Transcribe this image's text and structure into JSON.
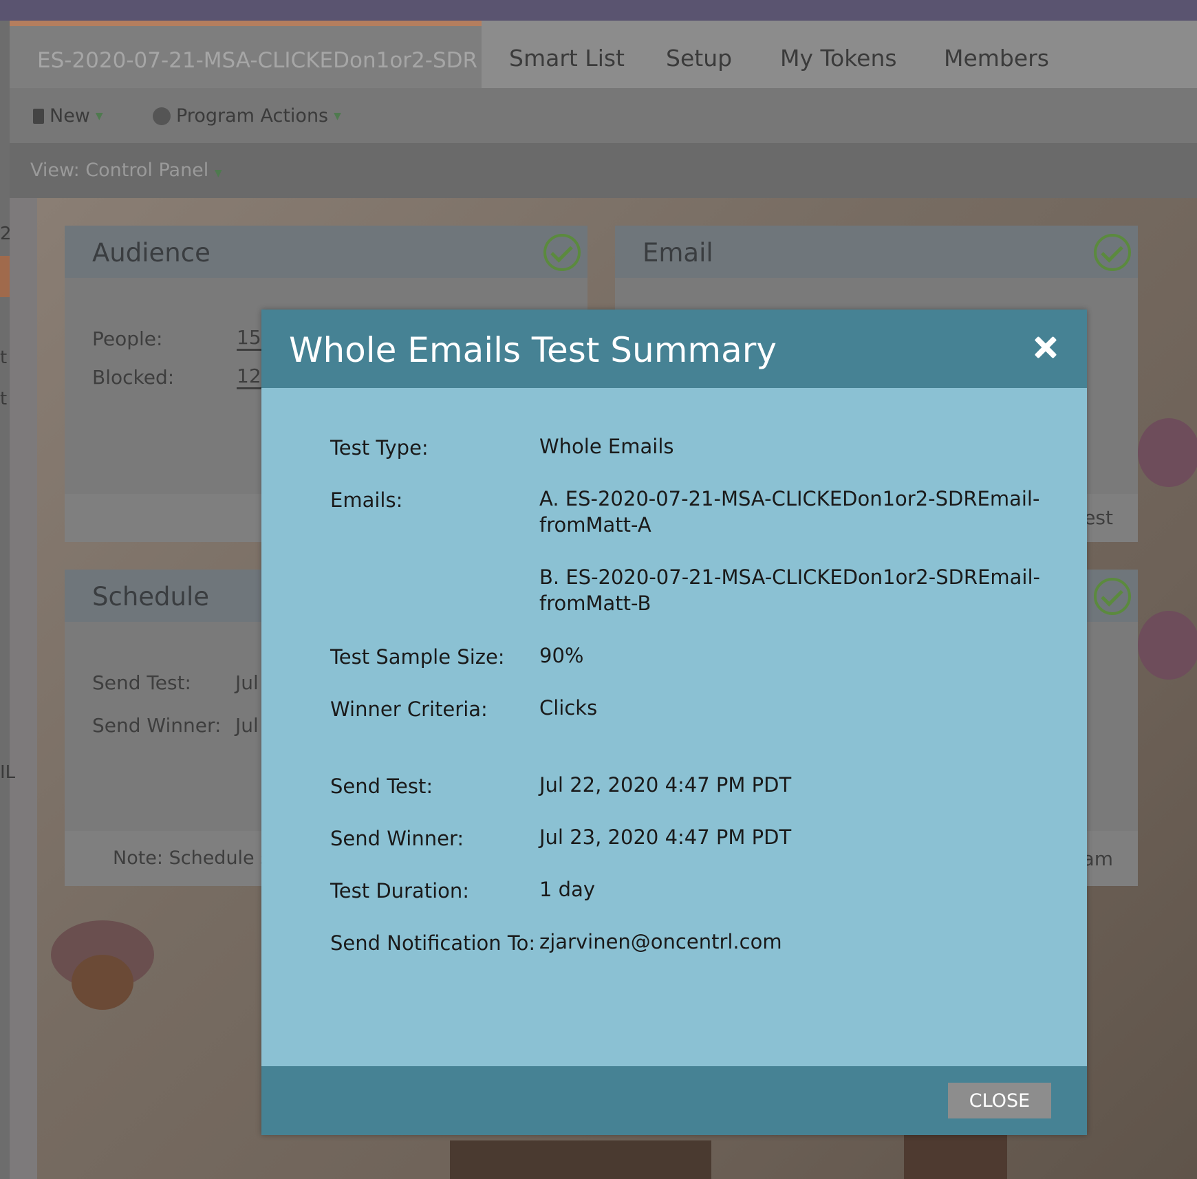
{
  "tabs": {
    "active": "ES-2020-07-21-MSA-CLICKEDon1or2-SDR",
    "items": [
      "Smart List",
      "Setup",
      "My Tokens",
      "Members"
    ]
  },
  "toolbar": {
    "new_label": "New",
    "program_actions_label": "Program Actions"
  },
  "view": {
    "label": "View: Control Panel"
  },
  "edge": {
    "t1": "2",
    "t2": "t",
    "t3": "t",
    "t4": "IL"
  },
  "audience": {
    "title": "Audience",
    "people_label": "People:",
    "people_value": "15",
    "blocked_label": "Blocked:",
    "blocked_value": "12"
  },
  "email_panel": {
    "title": "Email",
    "foot_partial": "est"
  },
  "schedule": {
    "title": "Schedule",
    "send_test_label": "Send Test:",
    "send_test_value": "Jul",
    "send_winner_label": "Send Winner:",
    "send_winner_value": "Jul",
    "note": "Note: Schedule se"
  },
  "right_partial": {
    "foot": "am"
  },
  "modal": {
    "title": "Whole Emails Test Summary",
    "close_label": "CLOSE",
    "rows": {
      "test_type": {
        "label": "Test Type:",
        "value": "Whole Emails"
      },
      "emails": {
        "label": "Emails:",
        "a": "A. ES-2020-07-21-MSA-CLICKEDon1or2-SDREmail-fromMatt-A",
        "b": "B. ES-2020-07-21-MSA-CLICKEDon1or2-SDREmail-fromMatt-B"
      },
      "sample_size": {
        "label": "Test Sample Size:",
        "value": "90%"
      },
      "winner_criteria": {
        "label": "Winner Criteria:",
        "value": "Clicks"
      },
      "send_test": {
        "label": "Send Test:",
        "value": "Jul 22, 2020 4:47 PM PDT"
      },
      "send_winner": {
        "label": "Send Winner:",
        "value": "Jul 23, 2020 4:47 PM PDT"
      },
      "test_duration": {
        "label": "Test Duration:",
        "value": "1 day"
      },
      "notification": {
        "label": "Send Notification To:",
        "value": "zjarvinen@oncentrl.com"
      }
    }
  },
  "colors": {
    "top_bar": "#5a5470",
    "modal_header": "#468294",
    "modal_body": "#8bc1d3",
    "check": "#5b8a3e"
  }
}
